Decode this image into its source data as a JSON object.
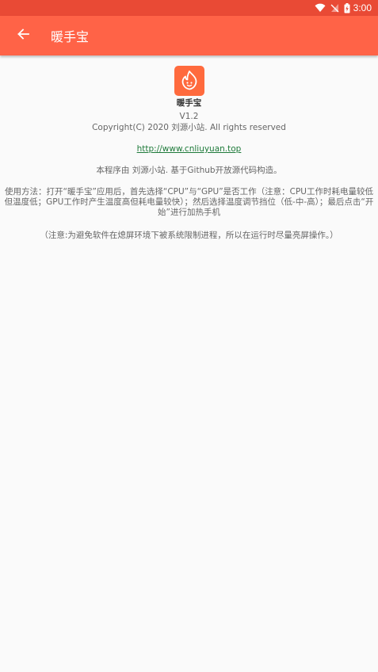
{
  "status_bar": {
    "time": "3:00"
  },
  "app_bar": {
    "title": "暖手宝"
  },
  "about": {
    "app_name": "暖手宝",
    "version": "V1.2",
    "copyright": "Copyright(C) 2020 刘源小站. All rights reserved",
    "website": "http://www.cnliuyuan.top",
    "description": "本程序由 刘源小站. 基于Github开放源代码构造。",
    "usage": "使用方法：打开“暖手宝”应用后，首先选择“CPU”与“GPU”是否工作（注意：CPU工作时耗电量较低但温度低；GPU工作时产生温度高但耗电量较快）；然后选择温度调节挡位（低-中-高）；最后点击“开始”进行加热手机",
    "note": "（注意:为避免软件在熄屏环境下被系统限制进程，所以在运行时尽量亮屏操作。）"
  },
  "icons": {
    "back": "arrow-back-icon",
    "logo": "flame-face-icon",
    "wifi": "wifi-icon",
    "signal": "no-signal-icon",
    "battery": "battery-charging-icon"
  },
  "colors": {
    "app_bar": "#ff6347",
    "status_bar": "#e94a35",
    "logo_bg": "#ff6a3d",
    "link": "#1e7a3a",
    "background": "#fafafa"
  }
}
